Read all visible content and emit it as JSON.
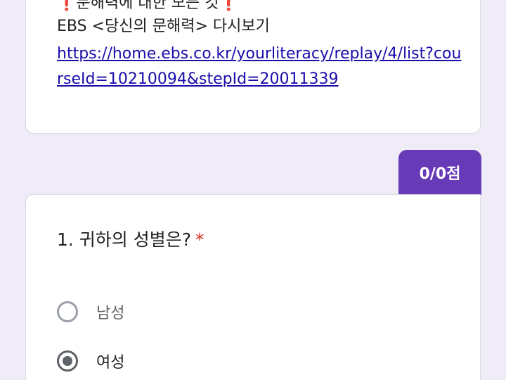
{
  "description": {
    "line1": "❗문해력에 대한 모든 것❗",
    "line2": "EBS <당신의 문해력> 다시보기",
    "link": "https://home.ebs.co.kr/yourliteracy/replay/4/list?courseId=10210094&stepId=20011339"
  },
  "score": {
    "label": "0/0점"
  },
  "question": {
    "title": "1. 귀하의 성별은?",
    "required_mark": "*",
    "options": [
      {
        "label": "남성",
        "selected": false
      },
      {
        "label": "여성",
        "selected": true
      }
    ]
  },
  "colors": {
    "background": "#efebf7",
    "accent": "#673ab7",
    "link": "#1a0dab",
    "required": "#d93025"
  }
}
